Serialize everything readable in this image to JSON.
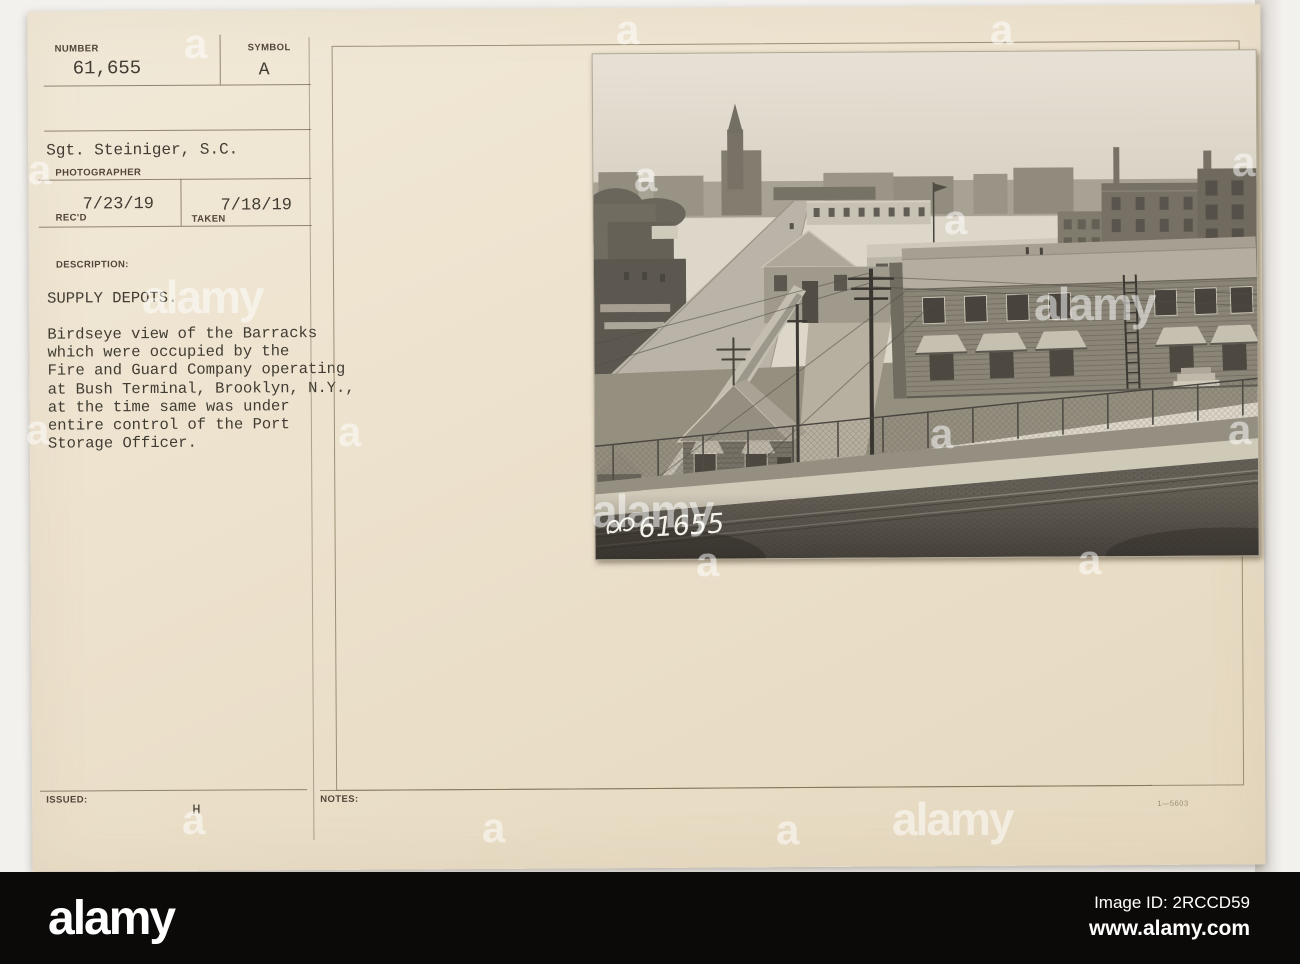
{
  "card": {
    "background": "#ece1cc",
    "fields": {
      "number": {
        "label": "NUMBER",
        "value": "61,655"
      },
      "symbol": {
        "label": "SYMBOL",
        "value": "A"
      },
      "photographer": {
        "label": "PHOTOGRAPHER",
        "value": "Sgt. Steiniger, S.C."
      },
      "received": {
        "label": "REC'D",
        "value": "7/23/19"
      },
      "taken": {
        "label": "TAKEN",
        "value": "7/18/19"
      },
      "description": {
        "label": "DESCRIPTION:",
        "title": "SUPPLY DEPOTS.",
        "lines": [
          "Birdseye view of the Barracks",
          "which were occupied by the",
          "Fire and Guard Company operating",
          "at Bush Terminal, Brooklyn, N.Y.,",
          "at the time same was under",
          "entire control of the Port",
          "Storage Officer."
        ]
      },
      "issued": {
        "label": "ISSUED:",
        "value": "H"
      },
      "notes": {
        "label": "NOTES:"
      },
      "print_code": "1—5603"
    }
  },
  "photo": {
    "handwritten_number": "61655"
  },
  "watermark": {
    "word": "alamy",
    "letter": "a",
    "color": "#ffffff"
  },
  "footer": {
    "background": "#0b0a08",
    "logo": "alamy",
    "image_id_label": "Image ID:",
    "image_id": "2RCCD59",
    "website": "www.alamy.com"
  }
}
